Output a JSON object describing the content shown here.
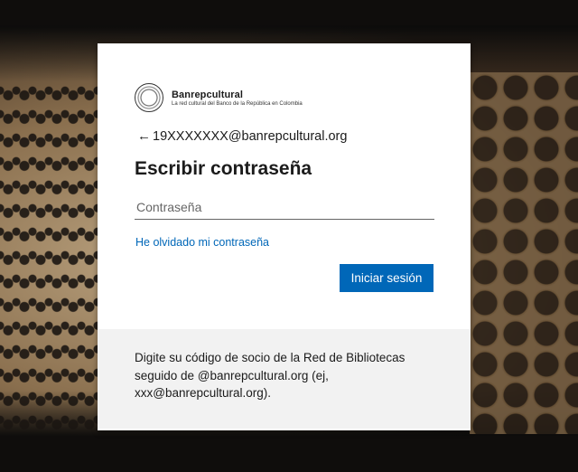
{
  "brand": {
    "name": "Banrepcultural",
    "tagline": "La red cultural del Banco de la República en Colombia"
  },
  "identity": {
    "back_icon": "←",
    "email": "19XXXXXXX@banrepcultural.org"
  },
  "title": "Escribir contraseña",
  "password": {
    "placeholder": "Contraseña",
    "value": ""
  },
  "forgot_link": "He olvidado mi contraseña",
  "signin_button": "Iniciar sesión",
  "info_text": "Digite su código de socio de la Red de Bibliotecas seguido de @banrepcultural.org (ej, xxx@banrepcultural.org).",
  "colors": {
    "accent": "#0067b8",
    "info_bg": "#f2f2f2"
  }
}
